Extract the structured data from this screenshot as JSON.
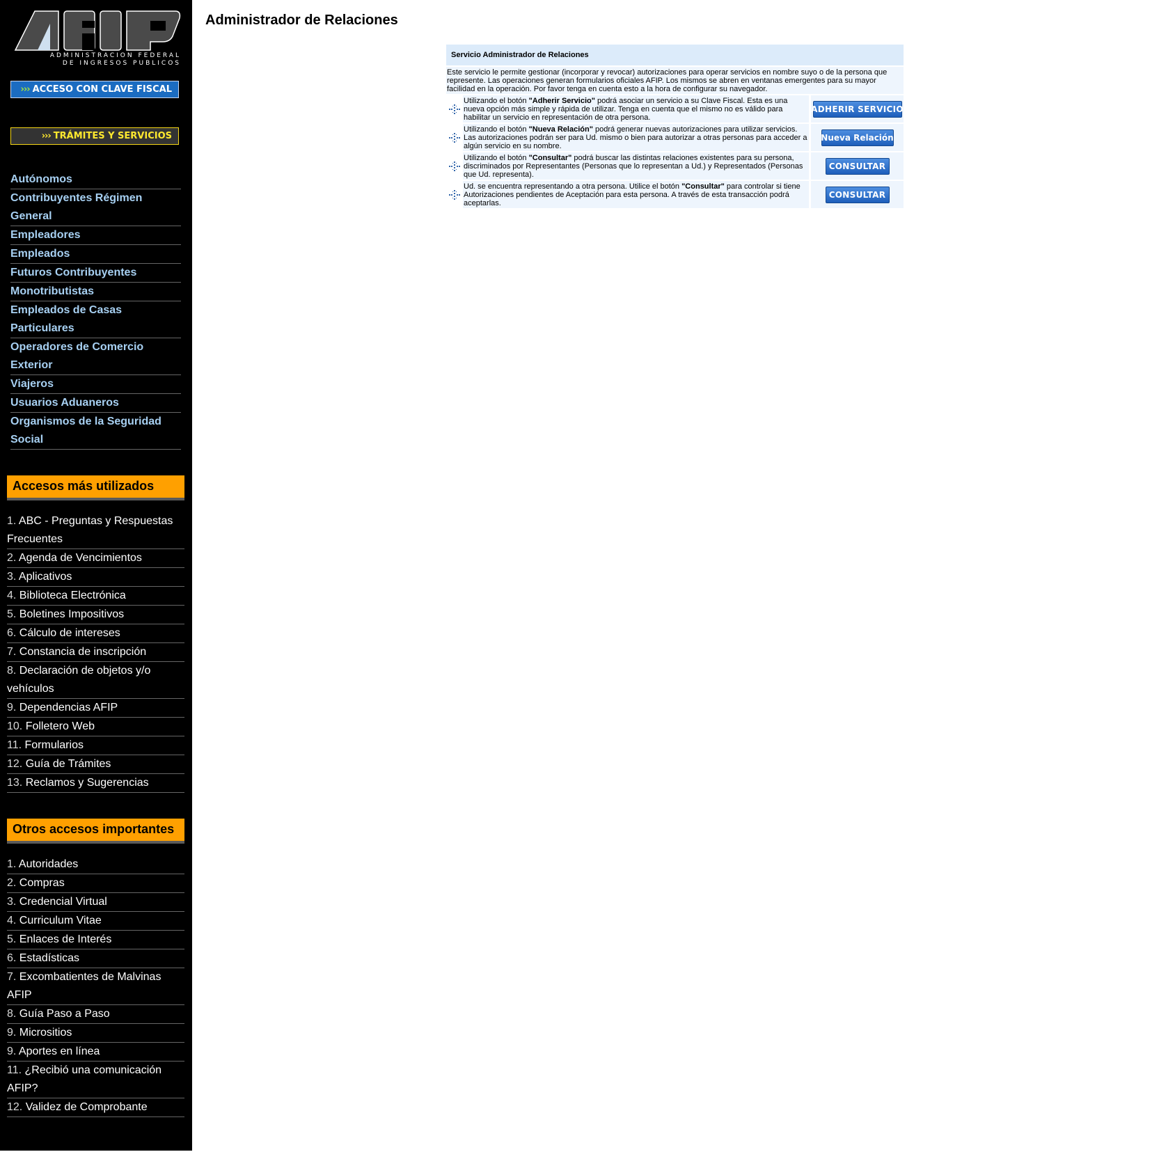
{
  "logo": {
    "text": "AFIP",
    "line1": "ADMINISTRACION FEDERAL",
    "line2": "DE INGRESOS PUBLICOS"
  },
  "sidebar": {
    "clave_fiscal": {
      "arrows": "›››",
      "label": "ACCESO CON CLAVE FISCAL"
    },
    "tramites": {
      "arrows": "›››",
      "label": "TRÁMITES Y SERVICIOS"
    },
    "profiles": [
      "Autónomos",
      "Contribuyentes Régimen General",
      "Empleadores",
      "Empleados",
      "Futuros Contribuyentes",
      "Monotributistas",
      "Empleados de Casas Particulares",
      "Operadores de Comercio Exterior",
      "Viajeros",
      "Usuarios Aduaneros",
      "Organismos de la Seguridad Social"
    ],
    "accesos": {
      "title": "Accesos más utilizados",
      "items": [
        {
          "num": "1.",
          "label": "ABC - Preguntas y Respuestas Frecuentes"
        },
        {
          "num": "2.",
          "label": "Agenda de Vencimientos"
        },
        {
          "num": "3.",
          "label": "Aplicativos"
        },
        {
          "num": "4.",
          "label": "Biblioteca Electrónica"
        },
        {
          "num": "5.",
          "label": "Boletines Impositivos"
        },
        {
          "num": "6.",
          "label": "Cálculo de intereses"
        },
        {
          "num": "7.",
          "label": "Constancia de inscripción"
        },
        {
          "num": "8.",
          "label": "Declaración de objetos y/o vehículos"
        },
        {
          "num": "9.",
          "label": "Dependencias AFIP"
        },
        {
          "num": "10.",
          "label": "Folletero Web"
        },
        {
          "num": "11.",
          "label": "Formularios"
        },
        {
          "num": "12.",
          "label": "Guía de Trámites"
        },
        {
          "num": "13.",
          "label": "Reclamos y Sugerencias"
        }
      ]
    },
    "otros": {
      "title": "Otros accesos importantes",
      "items": [
        {
          "num": "1.",
          "label": "Autoridades"
        },
        {
          "num": "2.",
          "label": "Compras"
        },
        {
          "num": "3.",
          "label": "Credencial Virtual"
        },
        {
          "num": "4.",
          "label": "Curriculum Vitae"
        },
        {
          "num": "5.",
          "label": "Enlaces de Interés"
        },
        {
          "num": "6.",
          "label": "Estadísticas"
        },
        {
          "num": "7.",
          "label": "Excombatientes de Malvinas AFIP"
        },
        {
          "num": "8.",
          "label": "Guía Paso a Paso"
        },
        {
          "num": "9.",
          "label": "Micrositios"
        },
        {
          "num": "9.",
          "label": "Aportes en línea"
        },
        {
          "num": "11.",
          "label": "¿Recibió una comunicación AFIP?"
        },
        {
          "num": "12.",
          "label": "Validez de Comprobante"
        }
      ]
    }
  },
  "main": {
    "title": "Administrador de Relaciones",
    "panel_title": "Servicio Administrador de Relaciones",
    "intro": "Este servicio le permite gestionar (incorporar y revocar) autorizaciones para operar servicios en nombre suyo o de la persona que represente. Las operaciones generan formularios oficiales AFIP. Los mismos se abren en ventanas emergentes para su mayor facilidad en la operación. Por favor tenga en cuenta esto a la hora de configurar su navegador.",
    "rows": [
      {
        "pre": "Utilizando el botón ",
        "bold": "\"Adherir Servicio\"",
        "post": " podrá asociar un servicio a su Clave Fiscal. Esta es una nueva opción más simple y rápida de utilizar. Tenga en cuenta que el mismo no es válido para habilitar un servicio en representación de otra persona.",
        "button": "ADHERIR SERVICIO"
      },
      {
        "pre": "Utilizando el botón ",
        "bold": "\"Nueva Relación\"",
        "post": " podrá generar nuevas autorizaciones para utilizar servicios. Las autorizaciones podrán ser para Ud. mismo o bien para autorizar a otras personas para acceder a algún servicio en su nombre.",
        "button": "Nueva Relación"
      },
      {
        "pre": "Utilizando el botón ",
        "bold": "\"Consultar\"",
        "post": " podrá buscar las distintas relaciones existentes para su persona, discriminados por Representantes (Personas que lo representan a Ud.) y Representados (Personas que Ud. representa).",
        "button": "CONSULTAR"
      },
      {
        "pre": "Ud. se encuentra representando a otra persona. Utilice el botón ",
        "bold": "\"Consultar\"",
        "post": " para controlar si tiene Autorizaciones pendientes de Aceptación para esta persona. A través de esta transacción podrá aceptarlas.",
        "button": "CONSULTAR"
      }
    ]
  }
}
